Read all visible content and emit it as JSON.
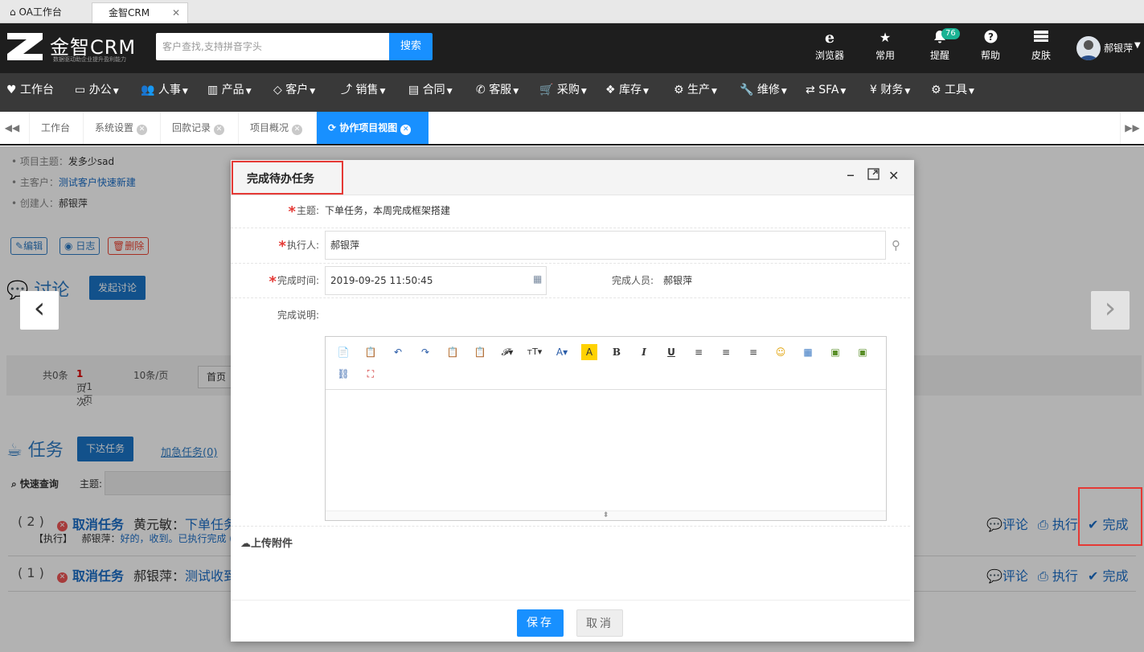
{
  "browser_tabs": [
    {
      "label": "OA工作台"
    },
    {
      "label": "金智CRM"
    }
  ],
  "header": {
    "logo_text": "金智CRM",
    "logo_sub": "数据驱动助企业提升盈利能力",
    "search_placeholder": "客户查找,支持拼音字头",
    "search_label": "搜索",
    "icons": [
      {
        "label": "浏览器",
        "icon": "ie-icon"
      },
      {
        "label": "常用",
        "icon": "star-icon"
      },
      {
        "label": "提醒",
        "icon": "bell-icon",
        "badge": "76"
      },
      {
        "label": "帮助",
        "icon": "help-icon"
      },
      {
        "label": "皮肤",
        "icon": "skin-icon"
      }
    ],
    "username": "郝银萍"
  },
  "main_nav": [
    {
      "label": "工作台",
      "icon": "heart-icon"
    },
    {
      "label": "办公",
      "icon": "laptop-icon"
    },
    {
      "label": "人事",
      "icon": "users-icon"
    },
    {
      "label": "产品",
      "icon": "barcode-icon"
    },
    {
      "label": "客户",
      "icon": "diamond-icon"
    },
    {
      "label": "销售",
      "icon": "chart-icon"
    },
    {
      "label": "合同",
      "icon": "newspaper-icon"
    },
    {
      "label": "客服",
      "icon": "phone-icon"
    },
    {
      "label": "采购",
      "icon": "cart-icon"
    },
    {
      "label": "库存",
      "icon": "cubes-icon"
    },
    {
      "label": "生产",
      "icon": "cogs-icon"
    },
    {
      "label": "维修",
      "icon": "wrench-icon"
    },
    {
      "label": "SFA",
      "icon": "retweet-icon"
    },
    {
      "label": "财务",
      "icon": "yen-icon"
    },
    {
      "label": "工具",
      "icon": "gear-icon"
    }
  ],
  "page_tabs": [
    {
      "label": "工作台"
    },
    {
      "label": "系统设置"
    },
    {
      "label": "回款记录"
    },
    {
      "label": "项目概况"
    },
    {
      "label": "协作项目视图"
    }
  ],
  "project": {
    "subject_label": "项目主题：",
    "subject": "发多少sad",
    "customer_label": "主客户：",
    "customer": "测试客户快速新建",
    "creator_label": "创建人：",
    "creator": "郝银萍",
    "btn_edit": "编辑",
    "btn_log": "日志",
    "btn_delete": "删除"
  },
  "discussion": {
    "title": "讨论",
    "start_btn": "发起讨论",
    "pager": {
      "total": "共0条",
      "page_label": "页次:",
      "page_current": "1",
      "page_total": "/1页",
      "per_page": "10条/页",
      "first": "首页"
    }
  },
  "tasks": {
    "title": "任务",
    "assign_btn": "下达任务",
    "urgent": "加急任务(0)",
    "quick_search": "快速查询",
    "subject_label": "主题:",
    "rows": [
      {
        "num": "( 2 )",
        "cancel": "取消任务",
        "person": "黄元敏：",
        "link": "下单任务",
        "sub_tag": "【执行】",
        "sub_person": "郝银萍：",
        "sub_text": "好的，收到。已执行完成 ("
      },
      {
        "num": "( 1 )",
        "cancel": "取消任务",
        "person": "郝银萍：",
        "link": "测试收到"
      }
    ],
    "actions": {
      "comment": "评论",
      "execute": "执行",
      "complete": "完成"
    }
  },
  "modal": {
    "title": "完成待办任务",
    "subject_label": "主题:",
    "subject_value": "下单任务，本周完成框架搭建",
    "executor_label": "执行人:",
    "executor_value": "郝银萍",
    "time_label": "完成时间:",
    "time_value": "2019-09-25 11:50:45",
    "completer_label": "完成人员:",
    "completer_value": "郝银萍",
    "desc_label": "完成说明:",
    "upload_label": "上传附件",
    "save_label": "保存",
    "cancel_label": "取消"
  },
  "colors": {
    "primary": "#1890ff",
    "nav_bg": "#393939",
    "header_bg": "#1e1e1e",
    "highlight": "#e53935",
    "badge": "#1ab394"
  }
}
